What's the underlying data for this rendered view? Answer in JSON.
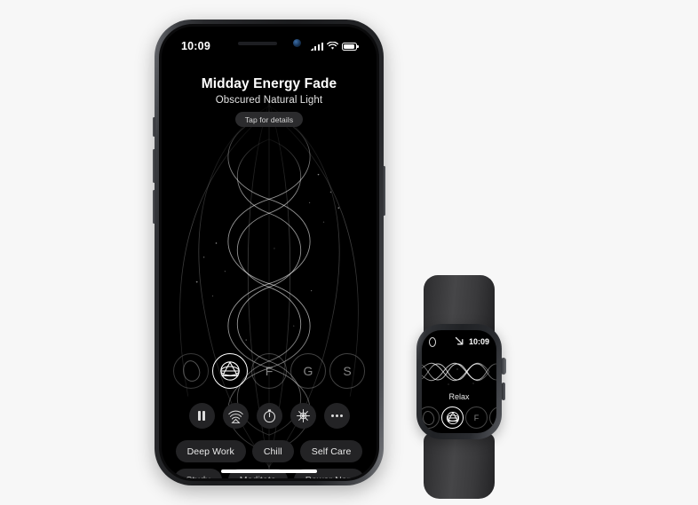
{
  "scene": {
    "background_color": "#f7f7f7",
    "devices": [
      "iphone",
      "apple-watch"
    ]
  },
  "phone": {
    "status_bar": {
      "time": "10:09",
      "cellular_icon": "signal-bars-icon",
      "wifi_icon": "wifi-icon",
      "battery_icon": "battery-icon"
    },
    "header": {
      "title": "Midday Energy Fade",
      "subtitle": "Obscured Natural Light",
      "details_chip": "Tap for details"
    },
    "artwork": {
      "name": "wave-visualization",
      "description": "Abstract interlocking sine wave strands with scattered star points"
    },
    "sound_circles": [
      {
        "label": "",
        "icon": "egg-outline-icon",
        "selected": false
      },
      {
        "label": "",
        "icon": "endel-logo-icon",
        "selected": true
      },
      {
        "label": "F",
        "icon": "",
        "selected": false
      },
      {
        "label": "G",
        "icon": "",
        "selected": false
      },
      {
        "label": "S",
        "icon": "",
        "selected": false
      }
    ],
    "controls": [
      {
        "name": "pause-button",
        "icon": "pause-icon"
      },
      {
        "name": "airplay-button",
        "icon": "airplay-broadcast-icon"
      },
      {
        "name": "timer-button",
        "icon": "timer-icon"
      },
      {
        "name": "effects-button",
        "icon": "sparkle-star-icon"
      },
      {
        "name": "more-button",
        "icon": "more-dots-icon"
      }
    ],
    "presets_row1": [
      "Deep Work",
      "Chill",
      "Self Care"
    ],
    "presets_row2": [
      "Study",
      "Meditate",
      "Power Nap"
    ],
    "home_indicator": "home-indicator-bar"
  },
  "watch": {
    "status": {
      "activity_icon": "activity-ring-icon",
      "direction_icon": "arrow-down-right-icon",
      "time": "10:09"
    },
    "artwork": {
      "name": "watch-wave-visualization",
      "description": "Interlocking looping wave strands"
    },
    "label": "Relax",
    "circles": [
      {
        "label": "",
        "icon": "egg-outline-icon",
        "selected": false
      },
      {
        "label": "",
        "icon": "endel-logo-icon",
        "selected": true
      },
      {
        "label": "F",
        "icon": "",
        "selected": false
      },
      {
        "label": "",
        "icon": "",
        "selected": false
      }
    ],
    "crown_icon": "digital-crown-icon",
    "side_button_icon": "side-button-icon",
    "band_color": "#3a3a3c"
  }
}
